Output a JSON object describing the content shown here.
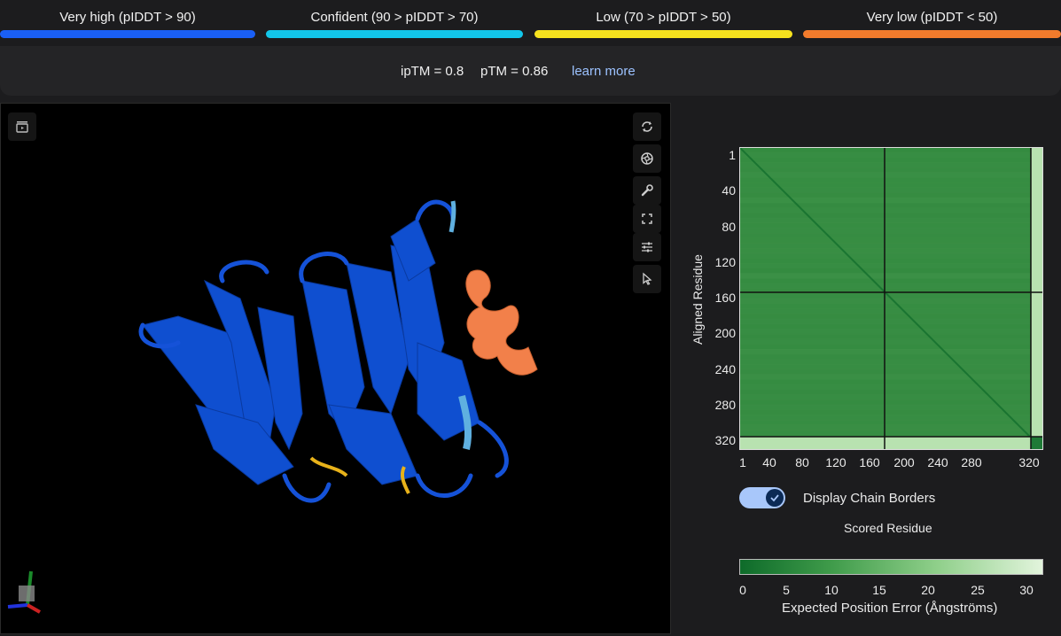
{
  "legend": [
    {
      "label": "Very high (pIDDT > 90)",
      "color": "#1a5ff5"
    },
    {
      "label": "Confident (90 > pIDDT > 70)",
      "color": "#12c6ea"
    },
    {
      "label": "Low (70 > pIDDT > 50)",
      "color": "#f6e21e"
    },
    {
      "label": "Very low (pIDDT < 50)",
      "color": "#f27b2c"
    }
  ],
  "scores": {
    "iptm": "ipTM = 0.8",
    "ptm": "pTM = 0.86",
    "learn_more": "learn more"
  },
  "viewer": {
    "tools": [
      "sequence-panel-icon",
      "reset-view-icon",
      "aperture-icon",
      "wrench-icon",
      "fullscreen-icon",
      "sliders-icon",
      "cursor-icon"
    ]
  },
  "pae": {
    "ylabel": "Aligned Residue",
    "xlabel": "Scored Residue",
    "y_ticks": [
      "1",
      "40",
      "80",
      "120",
      "160",
      "200",
      "240",
      "280",
      "320"
    ],
    "x_ticks": [
      "1",
      "40",
      "80",
      "120",
      "160",
      "200",
      "240",
      "280",
      "320"
    ],
    "chain_borders_label": "Display Chain Borders",
    "colorbar_ticks": [
      "0",
      "5",
      "10",
      "15",
      "20",
      "25",
      "30"
    ],
    "colorbar_title": "Expected Position Error (Ångströms)",
    "colors": {
      "low_error": "#0e6b2a",
      "high_error": "#e2f4dc"
    }
  }
}
